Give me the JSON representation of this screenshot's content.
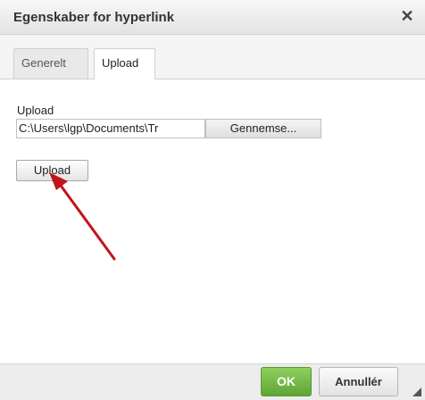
{
  "dialog": {
    "title": "Egenskaber for hyperlink",
    "close_icon": "close-icon",
    "close_glyph": "✕"
  },
  "tabs": [
    {
      "label": "Generelt",
      "active": false
    },
    {
      "label": "Upload",
      "active": true
    }
  ],
  "upload_tab": {
    "field_label": "Upload",
    "file_path_value": "C:\\Users\\lgp\\Documents\\Tr",
    "browse_label": "Gennemse...",
    "upload_button_label": "Upload"
  },
  "footer": {
    "ok_label": "OK",
    "cancel_label": "Annullér"
  },
  "colors": {
    "ok_button": "#6cb33f",
    "annotation_arrow": "#c0141c"
  }
}
